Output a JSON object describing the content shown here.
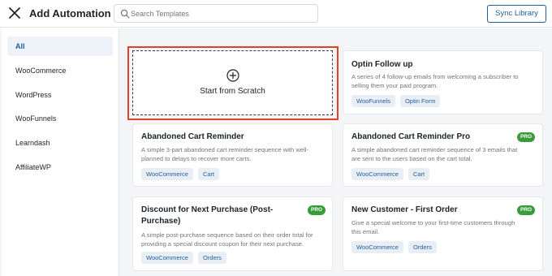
{
  "header": {
    "title": "Add Automation",
    "search_placeholder": "Search Templates",
    "sync_label": "Sync Library"
  },
  "sidebar": {
    "items": [
      {
        "label": "All",
        "active": true
      },
      {
        "label": "WooCommerce"
      },
      {
        "label": "WordPress"
      },
      {
        "label": "WooFunnels"
      },
      {
        "label": "Learndash"
      },
      {
        "label": "AffiliateWP"
      }
    ]
  },
  "scratch": {
    "label": "Start from Scratch",
    "icon": "plus-circle-icon",
    "highlight_color": "#e1412b"
  },
  "cards": [
    {
      "title": "Optin Follow up",
      "description_lines": [
        "A series of 4 follow-up emails from welcoming a subscriber to",
        "selling them your paid program."
      ],
      "tags": [
        "WooFunnels",
        "Optin Form"
      ],
      "pro": false
    },
    {
      "title": "Abandoned Cart Reminder",
      "description_lines": [
        "A simple 3-part abandoned cart reminder sequence with well-",
        "planned to delays to recover more carts."
      ],
      "tags": [
        "WooCommerce",
        "Cart"
      ],
      "pro": false
    },
    {
      "title": "Abandoned Cart Reminder Pro",
      "description_lines": [
        "A simple abandoned cart reminder sequence of 3 emails that",
        "are sent to the users based on the cart total."
      ],
      "tags": [
        "WooCommerce",
        "Cart"
      ],
      "pro": true,
      "pro_label": "PRO"
    },
    {
      "title_lines": [
        "Discount for Next Purchase (Post-",
        "Purchase)"
      ],
      "description_lines": [
        "A simple post-purchase sequence based on their order total for",
        "providing a special discount coupon for their next purchase."
      ],
      "tags": [
        "WooCommerce",
        "Orders"
      ],
      "pro": true,
      "pro_label": "PRO"
    },
    {
      "title": "New Customer - First Order",
      "description_lines": [
        "Give a special welcome to your first-time customers through",
        "this email."
      ],
      "tags": [
        "WooCommerce",
        "Orders"
      ],
      "pro": true,
      "pro_label": "PRO"
    }
  ],
  "colors": {
    "accent": "#1f5d9c",
    "pro_badge": "#3a9b3a",
    "tag_bg": "#e9eef4"
  }
}
